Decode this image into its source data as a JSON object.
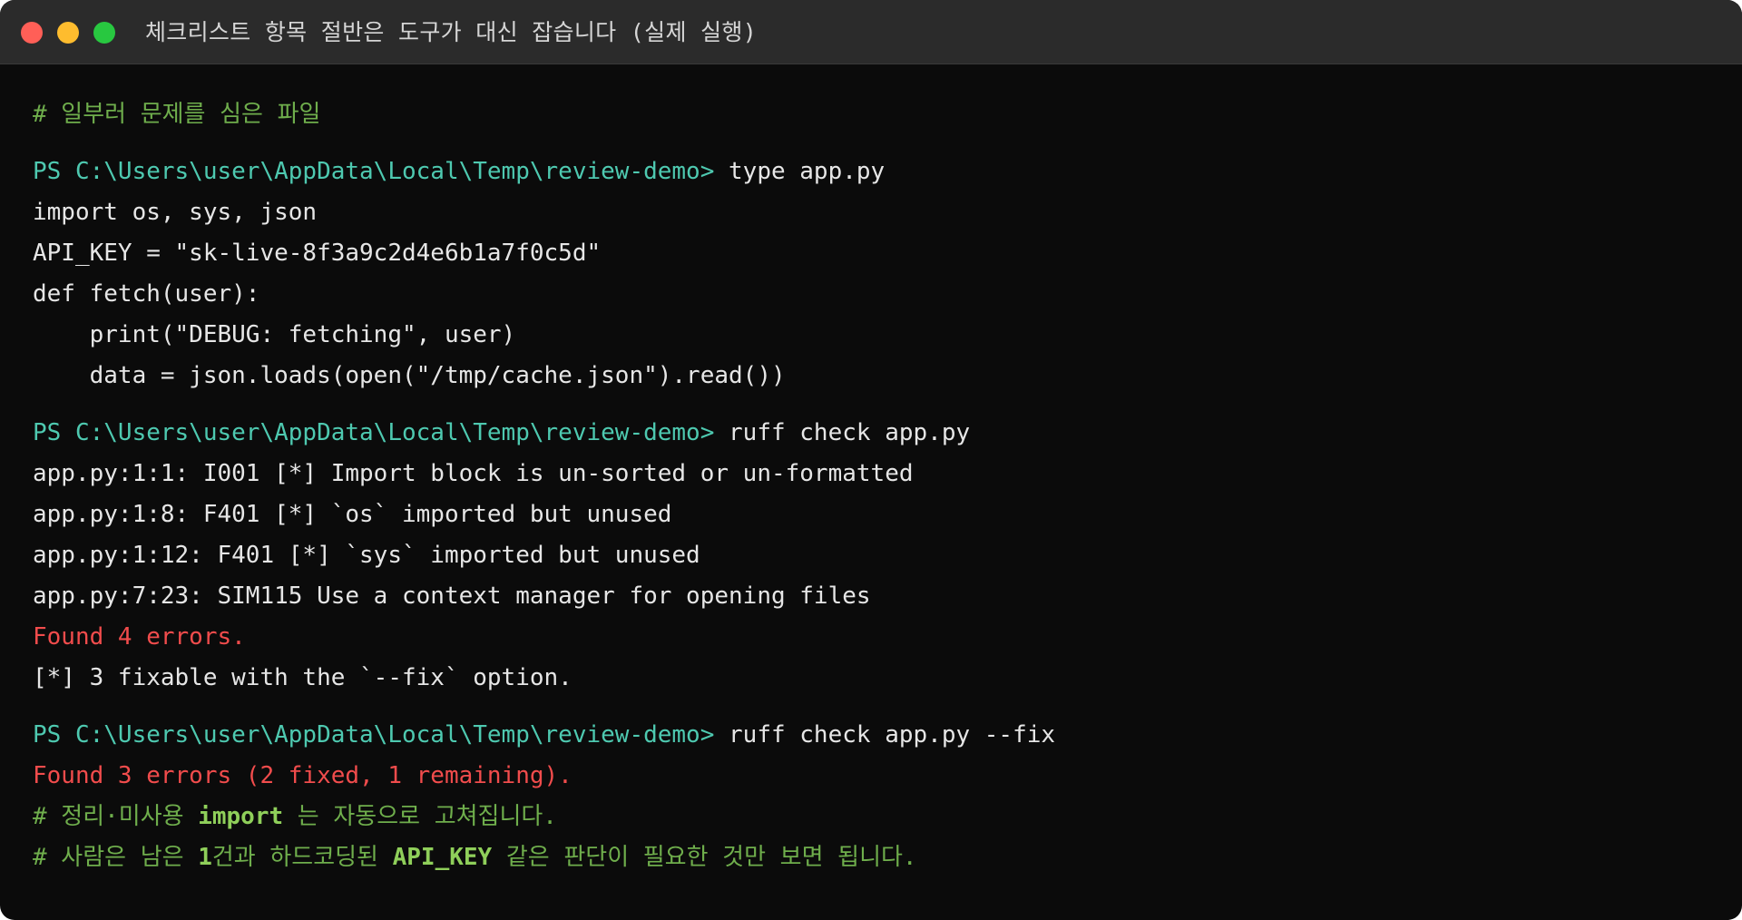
{
  "window": {
    "title": "체크리스트 항목 절반은 도구가 대신 잡습니다 (실제 실행)"
  },
  "terminal": {
    "comment_intro": "# 일부러 문제를 심은 파일",
    "block1": {
      "prompt": "PS C:\\Users\\user\\AppData\\Local\\Temp\\review-demo> ",
      "command": "type app.py",
      "output": [
        "import os, sys, json",
        "API_KEY = \"sk-live-8f3a9c2d4e6b1a7f0c5d\"",
        "def fetch(user):",
        "    print(\"DEBUG: fetching\", user)",
        "    data = json.loads(open(\"/tmp/cache.json\").read())"
      ]
    },
    "block2": {
      "prompt": "PS C:\\Users\\user\\AppData\\Local\\Temp\\review-demo> ",
      "command": "ruff check app.py",
      "output": [
        "app.py:1:1: I001 [*] Import block is un-sorted or un-formatted",
        "app.py:1:8: F401 [*] `os` imported but unused",
        "app.py:1:12: F401 [*] `sys` imported but unused",
        "app.py:7:23: SIM115 Use a context manager for opening files"
      ],
      "error_summary": "Found 4 errors.",
      "fix_hint": "[*] 3 fixable with the `--fix` option."
    },
    "block3": {
      "prompt": "PS C:\\Users\\user\\AppData\\Local\\Temp\\review-demo> ",
      "command": "ruff check app.py --fix",
      "error_summary": "Found 3 errors (2 fixed, 1 remaining).",
      "comment1": {
        "prefix": "# 정리·미사용 ",
        "keyword": "import",
        "suffix": " 는 자동으로 고쳐집니다."
      },
      "comment2": {
        "prefix": "# 사람은 남은 ",
        "keyword1": "1",
        "middle": "건과 하드코딩된 ",
        "keyword2": "API_KEY",
        "suffix": " 같은 판단이 필요한 것만 보면 됩니다."
      }
    }
  },
  "colors": {
    "background": "#0b0b0b",
    "titlebar": "#2b2b2b",
    "prompt": "#4ec9b0",
    "comment": "#6fae4c",
    "error": "#f14c4c",
    "text": "#e6e6e6"
  }
}
